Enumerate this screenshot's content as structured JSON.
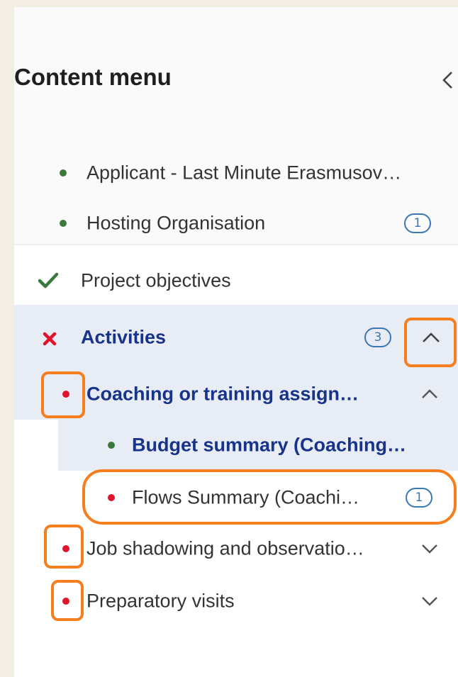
{
  "content_menu": {
    "title": "Content menu",
    "collapse_icon": "chevron-left-icon",
    "items": [
      {
        "label": "Applicant - Last Minute Erasmusov…",
        "status": "green-dot"
      },
      {
        "label": "Hosting Organisation",
        "status": "green-dot",
        "badge": "1"
      },
      {
        "label": "Project objectives",
        "status": "check-icon"
      },
      {
        "label": "Activities",
        "status": "x-icon",
        "badge": "3",
        "expanded": true
      },
      {
        "label": "Coaching or training assign…",
        "status": "red-dot",
        "expanded": true
      },
      {
        "label": "Budget summary (Coaching…",
        "status": "green-dot"
      },
      {
        "label": "Flows Summary (Coachi…",
        "status": "red-dot",
        "badge": "1"
      },
      {
        "label": "Job shadowing and observatio…",
        "status": "red-dot",
        "expanded": false
      },
      {
        "label": "Preparatory visits",
        "status": "red-dot",
        "expanded": false
      }
    ]
  },
  "colors": {
    "page_bg": "#f3eee4",
    "header_bg": "#fafafa",
    "selected_bg": "#e8ecf4",
    "green": "#3b7a3a",
    "red": "#e0142c",
    "link_blue": "#17348a",
    "badge_blue": "#3a77b5",
    "highlight": "#f57f1f"
  }
}
